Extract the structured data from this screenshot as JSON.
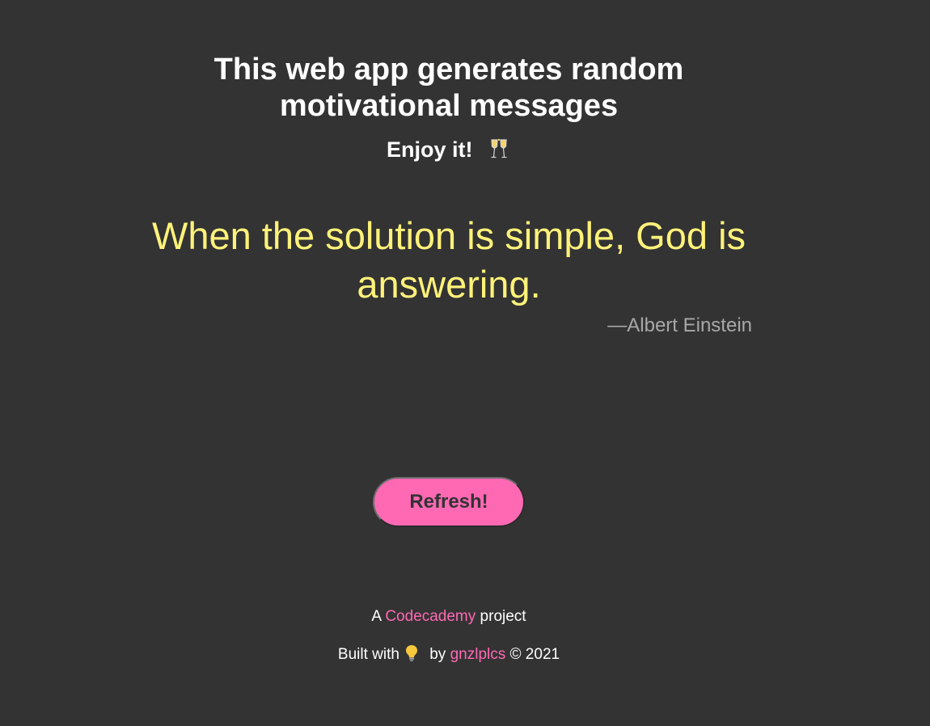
{
  "header": {
    "title": "This web app generates random motivational messages",
    "subtitle": "Enjoy it!",
    "subtitle_icon": "champagne-glasses-icon"
  },
  "quote": {
    "text": "When the solution is simple, God is answering.",
    "author": "—Albert Einstein"
  },
  "refresh_button": {
    "label": "Refresh!"
  },
  "footer": {
    "line1_prefix": "A",
    "codecademy_link": "Codecademy",
    "line1_suffix": "project",
    "line2_prefix": "Built with",
    "bulb_icon": "lightbulb-icon",
    "line2_by": "by",
    "author_link": "gnzlplcs",
    "copyright": "© 2021"
  },
  "colors": {
    "background": "#333333",
    "quote": "#fff27a",
    "author": "#a8a8a8",
    "accent": "#ff69b4",
    "button_text": "#333333"
  }
}
